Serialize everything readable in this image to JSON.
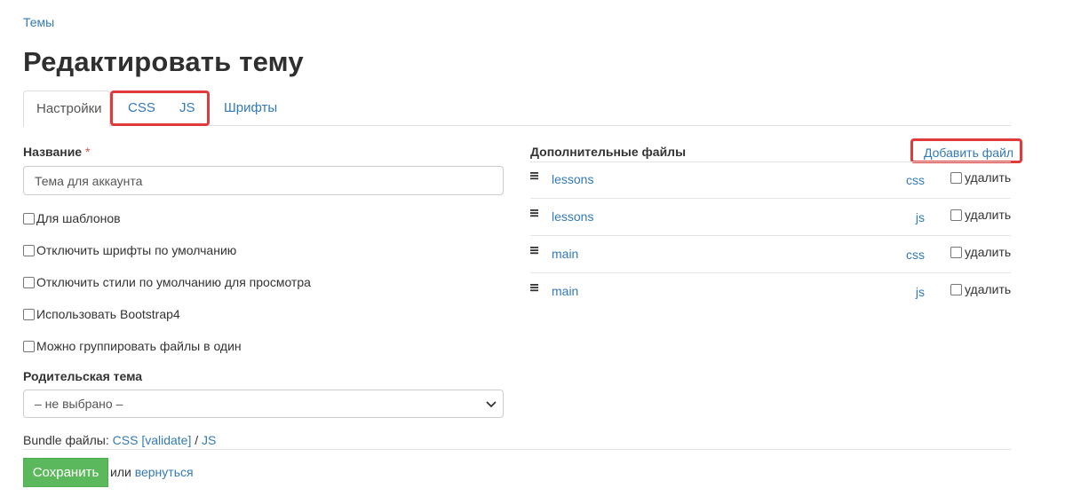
{
  "breadcrumb": {
    "label": "Темы"
  },
  "page": {
    "title": "Редактировать тему"
  },
  "tabs": [
    {
      "label": "Настройки",
      "active": true
    },
    {
      "label": "CSS",
      "active": false
    },
    {
      "label": "JS",
      "active": false
    },
    {
      "label": "Шрифты",
      "active": false
    }
  ],
  "form": {
    "name_label": "Название",
    "required_mark": "*",
    "name_value": "Тема для аккаунта",
    "checkboxes": [
      {
        "label": "Для шаблонов",
        "checked": false
      },
      {
        "label": "Отключить шрифты по умолчанию",
        "checked": false
      },
      {
        "label": "Отключить стили по умолчанию для просмотра",
        "checked": false
      },
      {
        "label": "Использовать Bootstrap4",
        "checked": false
      },
      {
        "label": "Можно группировать файлы в один",
        "checked": false
      }
    ],
    "parent_label": "Родительская тема",
    "parent_value": "– не выбрано –",
    "bundle_prefix": "Bundle файлы:",
    "bundle_css": "CSS",
    "bundle_bracket_open": "[",
    "bundle_validate": "validate",
    "bundle_bracket_close": "]",
    "bundle_slash": "/",
    "bundle_js": "JS",
    "save_label": "Сохранить",
    "or_text": "или",
    "back_label": "вернуться"
  },
  "files": {
    "title": "Дополнительные файлы",
    "add_label": "Добавить файл",
    "delete_label": "удалить",
    "items": [
      {
        "name": "lessons",
        "type": "css"
      },
      {
        "name": "lessons",
        "type": "js"
      },
      {
        "name": "main",
        "type": "css"
      },
      {
        "name": "main",
        "type": "js"
      }
    ]
  },
  "colors": {
    "link": "#337ab7",
    "highlight": "#e03a3a",
    "save": "#5cb85c"
  }
}
